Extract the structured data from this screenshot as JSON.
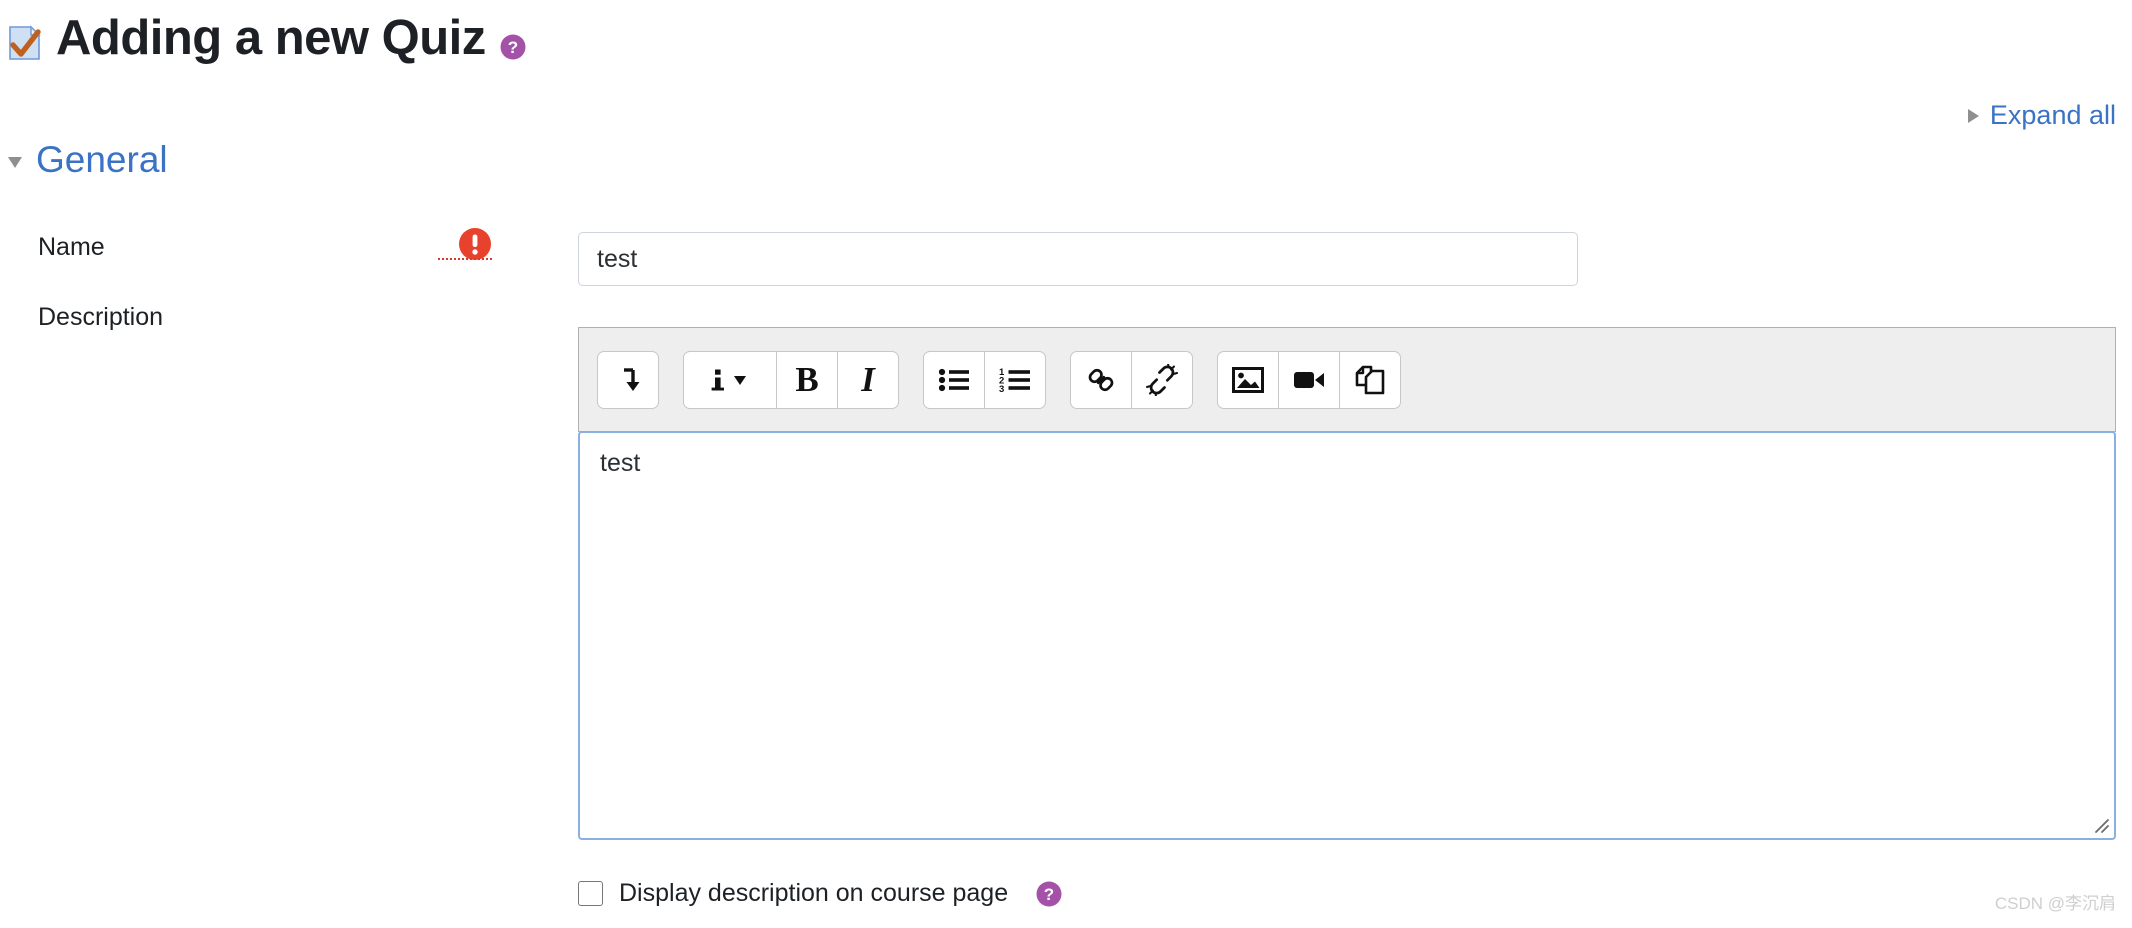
{
  "header": {
    "title": "Adding a new Quiz",
    "title_icon": "quiz-document-check-icon",
    "help_icon": "help-question-icon"
  },
  "expand_all": {
    "label": "Expand all",
    "icon": "triangle-right-icon"
  },
  "section": {
    "title": "General",
    "collapse_icon": "triangle-down-icon",
    "expanded": true
  },
  "form": {
    "name": {
      "label": "Name",
      "value": "test",
      "placeholder": "",
      "required": true,
      "required_icon": "required-exclamation-icon"
    },
    "description": {
      "label": "Description",
      "value": "test"
    },
    "display_description": {
      "label": "Display description on course page",
      "checked": false,
      "help_icon": "help-question-icon"
    }
  },
  "editor": {
    "toolbar_groups": [
      {
        "buttons": [
          {
            "name": "expand-toolbar-button",
            "icon": "arrow-turn-down-icon"
          }
        ]
      },
      {
        "buttons": [
          {
            "name": "paragraph-style-button",
            "icon": "info-caret-icon"
          },
          {
            "name": "bold-button",
            "icon": "bold-icon",
            "glyph": "B"
          },
          {
            "name": "italic-button",
            "icon": "italic-icon",
            "glyph": "I"
          }
        ]
      },
      {
        "buttons": [
          {
            "name": "bulleted-list-button",
            "icon": "bulleted-list-icon"
          },
          {
            "name": "numbered-list-button",
            "icon": "numbered-list-icon"
          }
        ]
      },
      {
        "buttons": [
          {
            "name": "insert-link-button",
            "icon": "link-icon"
          },
          {
            "name": "unlink-button",
            "icon": "unlink-icon"
          }
        ]
      },
      {
        "buttons": [
          {
            "name": "insert-image-button",
            "icon": "image-icon"
          },
          {
            "name": "insert-media-button",
            "icon": "video-camera-icon"
          },
          {
            "name": "manage-files-button",
            "icon": "copy-files-icon"
          }
        ]
      }
    ]
  },
  "watermark": {
    "text": "CSDN @李沉肩"
  },
  "colors": {
    "link_blue": "#3b73c4",
    "help_purple": "#a452a8",
    "required_red": "#e8412c",
    "focus_blue": "#89b0e0",
    "toolbar_bg": "#eeeeee"
  }
}
